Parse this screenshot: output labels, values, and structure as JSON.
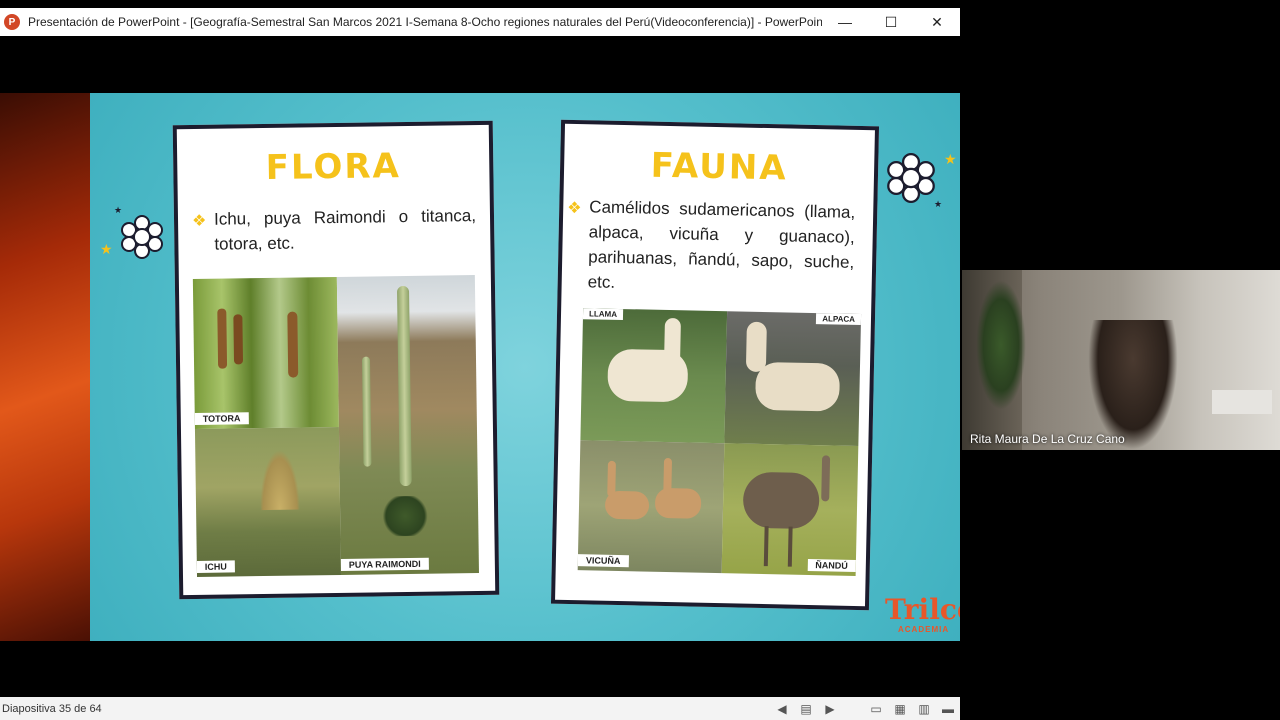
{
  "window": {
    "app_icon_letter": "P",
    "title": "Presentación de PowerPoint - [Geografía-Semestral San Marcos 2021 I-Semana 8-Ocho regiones naturales del Perú(Videoconferencia)] - PowerPoint (Err...",
    "minimize": "—",
    "maximize": "☐",
    "close": "✕"
  },
  "slide": {
    "flora": {
      "title": "FLORA",
      "text": "Ichu, puya Raimondi o titanca, totora, etc.",
      "photos": [
        "TOTORA",
        "ICHU",
        "PUYA RAIMONDI"
      ]
    },
    "fauna": {
      "title": "FAUNA",
      "text": "Camélidos sudamericanos (llama, alpaca, vicuña y guanaco), parihuanas, ñandú, sapo, suche, etc.",
      "photos": [
        "LLAMA",
        "ALPACA",
        "VICUÑA",
        "ÑANDÚ"
      ]
    },
    "logo": "Trilce",
    "logo_sub": "ACADEMIA"
  },
  "video": {
    "participant": "Rita Maura De La Cruz Cano"
  },
  "status": {
    "slide_counter": "Diapositiva 35 de 64"
  },
  "colors": {
    "accent_yellow": "#f5c21b",
    "slide_bg": "#55bfcc",
    "logo": "#e8572a"
  }
}
